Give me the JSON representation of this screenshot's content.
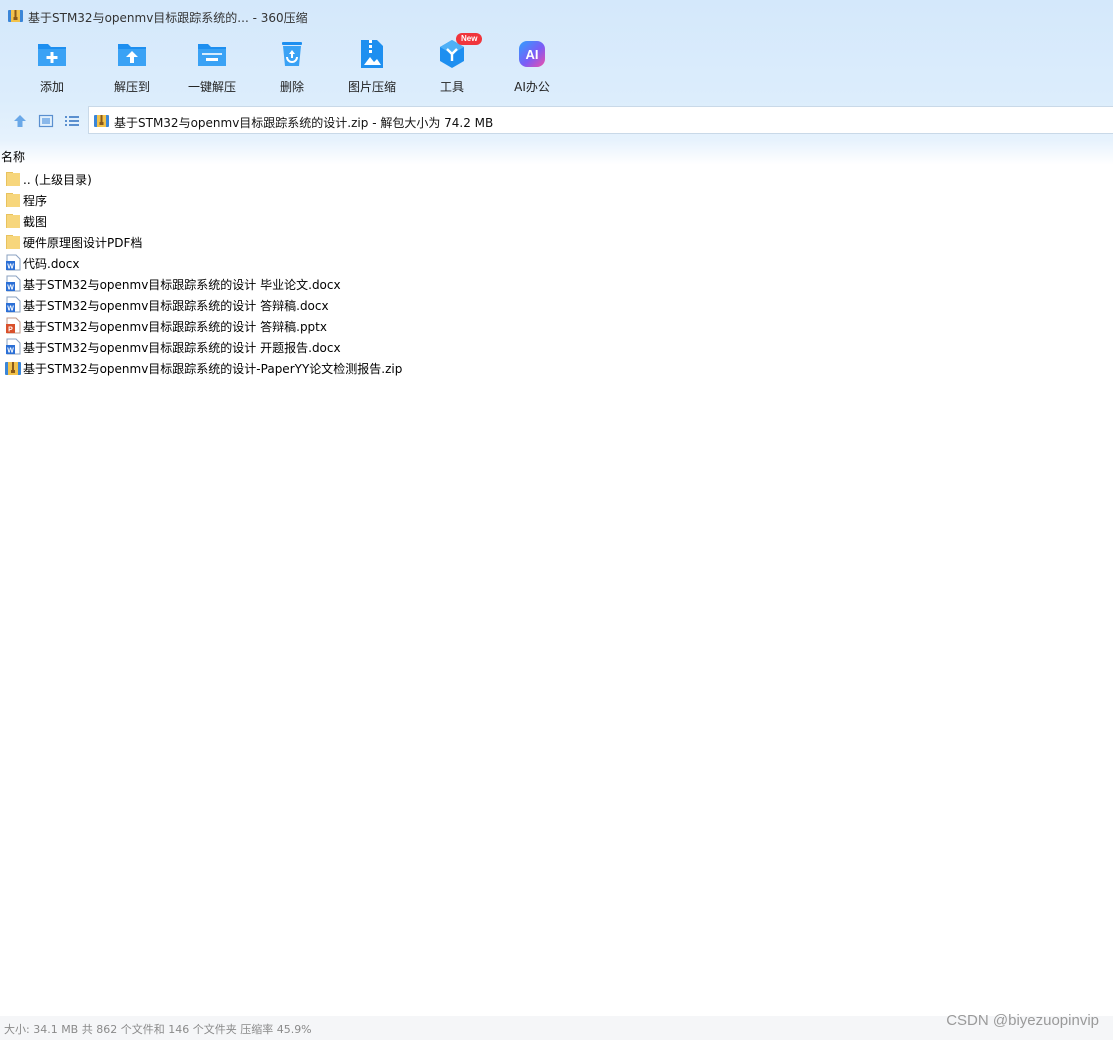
{
  "window": {
    "title": "基于STM32与openmv目标跟踪系统的... - 360压缩"
  },
  "toolbar": {
    "add_label": "添加",
    "extract_to_label": "解压到",
    "one_click_extract_label": "一键解压",
    "delete_label": "删除",
    "image_compress_label": "图片压缩",
    "tools_label": "工具",
    "tools_badge": "New",
    "ai_office_label": "AI办公",
    "ai_icon_text": "AI"
  },
  "address": {
    "path": "基于STM32与openmv目标跟踪系统的设计.zip - 解包大小为 74.2 MB"
  },
  "file_list": {
    "column_name": "名称",
    "items": [
      {
        "name": ".. (上级目录)",
        "type": "folder"
      },
      {
        "name": "程序",
        "type": "folder"
      },
      {
        "name": "截图",
        "type": "folder"
      },
      {
        "name": "硬件原理图设计PDF档",
        "type": "folder"
      },
      {
        "name": "代码.docx",
        "type": "docx"
      },
      {
        "name": "基于STM32与openmv目标跟踪系统的设计 毕业论文.docx",
        "type": "docx"
      },
      {
        "name": "基于STM32与openmv目标跟踪系统的设计 答辩稿.docx",
        "type": "docx"
      },
      {
        "name": "基于STM32与openmv目标跟踪系统的设计 答辩稿.pptx",
        "type": "pptx"
      },
      {
        "name": "基于STM32与openmv目标跟踪系统的设计 开题报告.docx",
        "type": "docx"
      },
      {
        "name": "基于STM32与openmv目标跟踪系统的设计-PaperYY论文检测报告.zip",
        "type": "zip"
      }
    ]
  },
  "status": {
    "text": "大小: 34.1 MB 共 862 个文件和 146 个文件夹 压缩率 45.9%"
  },
  "watermark": {
    "text": "CSDN @biyezuopinvip"
  },
  "colors": {
    "toolbar_icon": "#1e8ff0",
    "folder": "#f7d67c",
    "word": "#2b6fd6",
    "ppt": "#d9502b",
    "badge": "#f0353c"
  }
}
